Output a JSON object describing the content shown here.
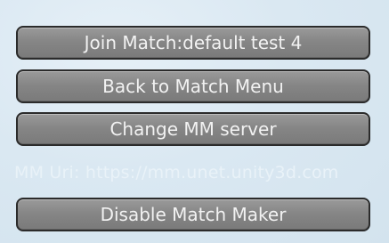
{
  "menu": {
    "join_match_label": "Join Match:default test 4",
    "back_label": "Back to Match Menu",
    "change_server_label": "Change MM server",
    "mm_url_text": "MM Uri: https://mm.unet.unity3d.com",
    "disable_label": "Disable Match Maker"
  },
  "colors": {
    "background": "#d9e8f2",
    "button_fill": "#868686",
    "button_border": "#2b2b2b",
    "button_text": "#f2f2f2",
    "label_text": "#e9f2f8"
  }
}
